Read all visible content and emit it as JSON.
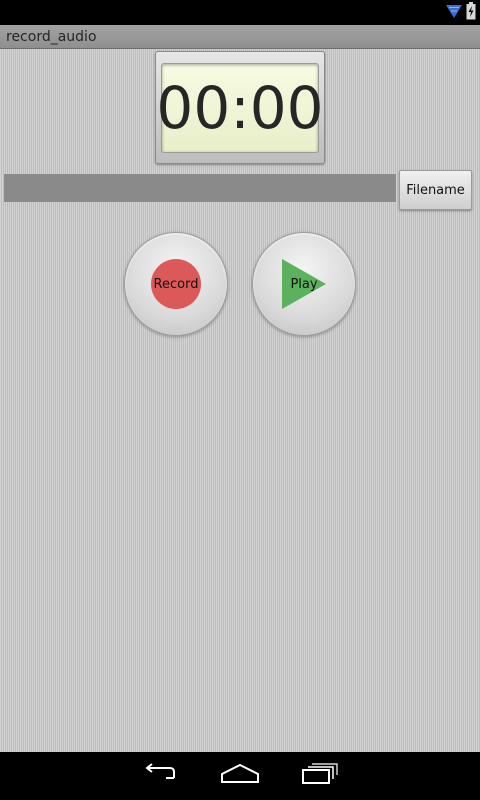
{
  "app": {
    "title": "record_audio"
  },
  "timer": {
    "display": "00:00"
  },
  "filename": {
    "value": "",
    "button_label": "Filename"
  },
  "controls": {
    "record_label": "Record",
    "play_label": "Play"
  },
  "icons": {
    "status_wifi": "wifi-icon",
    "status_battery": "battery-charging-icon",
    "nav_back": "back-icon",
    "nav_home": "home-icon",
    "nav_recents": "recents-icon"
  },
  "colors": {
    "record": "#dc5959",
    "play": "#5cb25c",
    "wifi": "#3b6fd1"
  }
}
